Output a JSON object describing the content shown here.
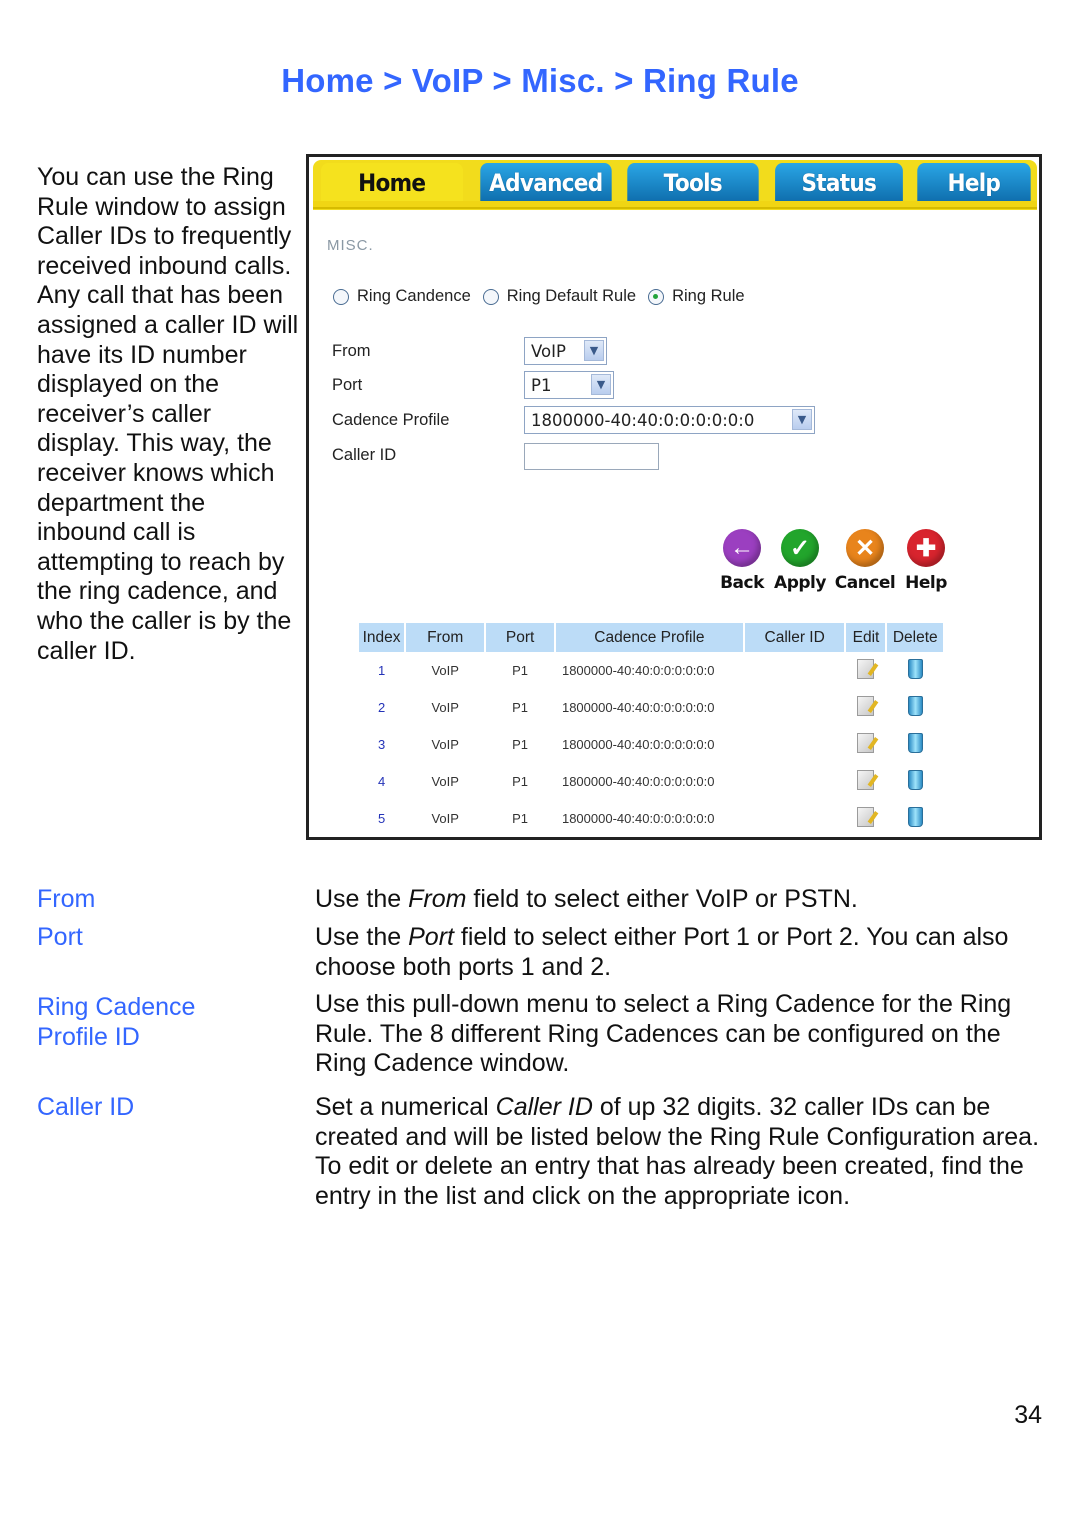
{
  "header": {
    "breadcrumb": "Home > VoIP > Misc. > Ring Rule"
  },
  "intro_text": "You can use the Ring Rule window to assign Caller IDs to frequently received inbound calls. Any call that has been assigned a caller ID will have its ID number displayed on the receiver’s caller display. This way, the receiver knows which department the inbound call is attempting to reach by the ring cadence, and who the caller is by the caller ID.",
  "screenshot": {
    "tabs": [
      {
        "label": "Home",
        "active": true
      },
      {
        "label": "Advanced",
        "active": false
      },
      {
        "label": "Tools",
        "active": false
      },
      {
        "label": "Status",
        "active": false
      },
      {
        "label": "Help",
        "active": false
      }
    ],
    "section_label": "MISC.",
    "radios": [
      {
        "label": "Ring Candence",
        "checked": false
      },
      {
        "label": "Ring Default Rule",
        "checked": false
      },
      {
        "label": "Ring Rule",
        "checked": true
      }
    ],
    "form": {
      "from_label": "From",
      "from_value": "VoIP",
      "port_label": "Port",
      "port_value": "P1",
      "cadence_label": "Cadence Profile",
      "cadence_value": "1800000-40:40:0:0:0:0:0:0",
      "caller_id_label": "Caller ID",
      "caller_id_value": ""
    },
    "actions": [
      {
        "label": "Back",
        "icon": "back-arrow-icon",
        "color": "#9b3fc0"
      },
      {
        "label": "Apply",
        "icon": "check-icon",
        "color": "#22a52c"
      },
      {
        "label": "Cancel",
        "icon": "x-icon",
        "color": "#e8841c"
      },
      {
        "label": "Help",
        "icon": "plus-icon",
        "color": "#d8242e"
      }
    ],
    "table": {
      "headers": [
        "Index",
        "From",
        "Port",
        "Cadence Profile",
        "Caller ID",
        "Edit",
        "Delete"
      ],
      "rows": [
        {
          "index": "1",
          "from": "VoIP",
          "port": "P1",
          "profile": "1800000-40:40:0:0:0:0:0:0",
          "caller_id": ""
        },
        {
          "index": "2",
          "from": "VoIP",
          "port": "P1",
          "profile": "1800000-40:40:0:0:0:0:0:0",
          "caller_id": ""
        },
        {
          "index": "3",
          "from": "VoIP",
          "port": "P1",
          "profile": "1800000-40:40:0:0:0:0:0:0",
          "caller_id": ""
        },
        {
          "index": "4",
          "from": "VoIP",
          "port": "P1",
          "profile": "1800000-40:40:0:0:0:0:0:0",
          "caller_id": ""
        },
        {
          "index": "5",
          "from": "VoIP",
          "port": "P1",
          "profile": "1800000-40:40:0:0:0:0:0:0",
          "caller_id": ""
        }
      ]
    }
  },
  "definitions": [
    {
      "term": "From",
      "pre": "Use the ",
      "em": "From",
      "post": " field to select either VoIP or PSTN."
    },
    {
      "term": "Port",
      "pre": "Use the ",
      "em": "Port",
      "post": " field to select either Port 1 or Port 2. You can also choose both ports 1 and 2."
    },
    {
      "term": "Ring Cadence Profile ID",
      "pre": "",
      "em": "",
      "post": "Use this pull-down menu to select a Ring Cadence for the Ring Rule. The 8 different Ring Cadences can be configured on the Ring Cadence window."
    },
    {
      "term": "Caller ID",
      "pre": "Set a numerical ",
      "em": "Caller ID",
      "post": " of up 32 digits. 32 caller IDs can be created and will be listed below the Ring Rule Configuration area. To edit or delete an entry that has already been created, find the entry in the list and click on the appropriate icon."
    }
  ],
  "page_number": "34"
}
